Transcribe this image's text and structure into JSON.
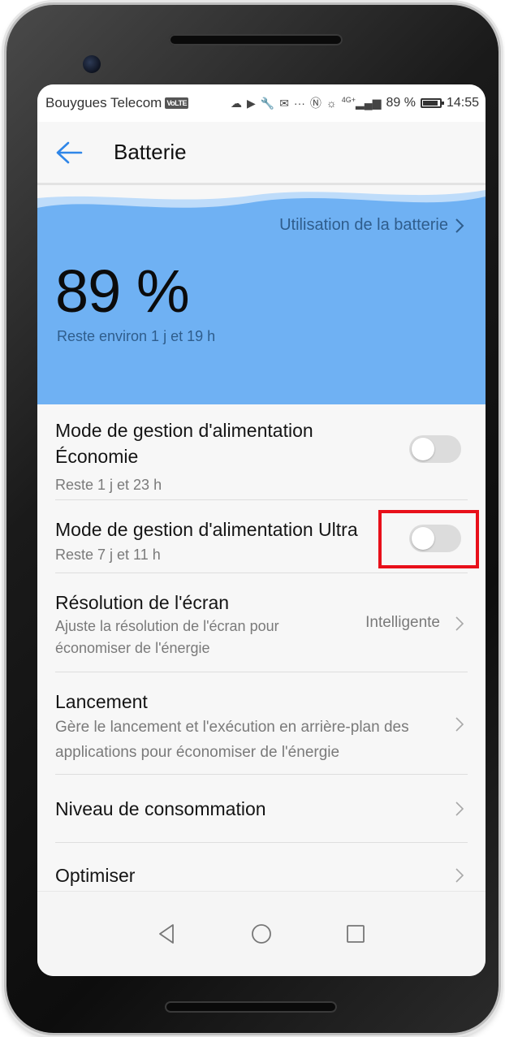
{
  "status_bar": {
    "carrier": "Bouygues Telecom",
    "volte_badge": "VoLTE",
    "network_badge": "4G+",
    "battery_level": "89 %",
    "time": "14:55",
    "battery_fraction": 0.89
  },
  "toolbar": {
    "title": "Batterie",
    "back_icon": "arrow-left-icon"
  },
  "battery_panel": {
    "usage_link": "Utilisation de la batterie",
    "percentage": "89 %",
    "remaining": "Reste environ 1 j et 19 h",
    "background_color": "#6fb1f3"
  },
  "settings": [
    {
      "title_line1": "Mode de gestion d'alimentation",
      "title_line2": "Économie",
      "subtitle": "Reste 1 j et 23 h",
      "toggle_on": false
    },
    {
      "title": "Mode de gestion d'alimentation Ultra",
      "subtitle": "Reste 7 j et 11 h",
      "toggle_on": false
    },
    {
      "title": "Résolution de l'écran",
      "subtitle_line1": "Ajuste la résolution de l'écran pour",
      "subtitle_line2": "économiser de l'énergie",
      "value": "Intelligente"
    },
    {
      "title": "Lancement",
      "subtitle_line1": "Gère le lancement et l'exécution en arrière-plan des",
      "subtitle_line2": "applications pour économiser de l'énergie"
    },
    {
      "title": "Niveau de consommation"
    },
    {
      "title": "Optimiser"
    }
  ],
  "nav_bar": {
    "back_icon": "triangle-back-icon",
    "home_icon": "circle-home-icon",
    "recents_icon": "square-recents-icon"
  },
  "annotation": {
    "highlight_color": "#e8101a"
  }
}
